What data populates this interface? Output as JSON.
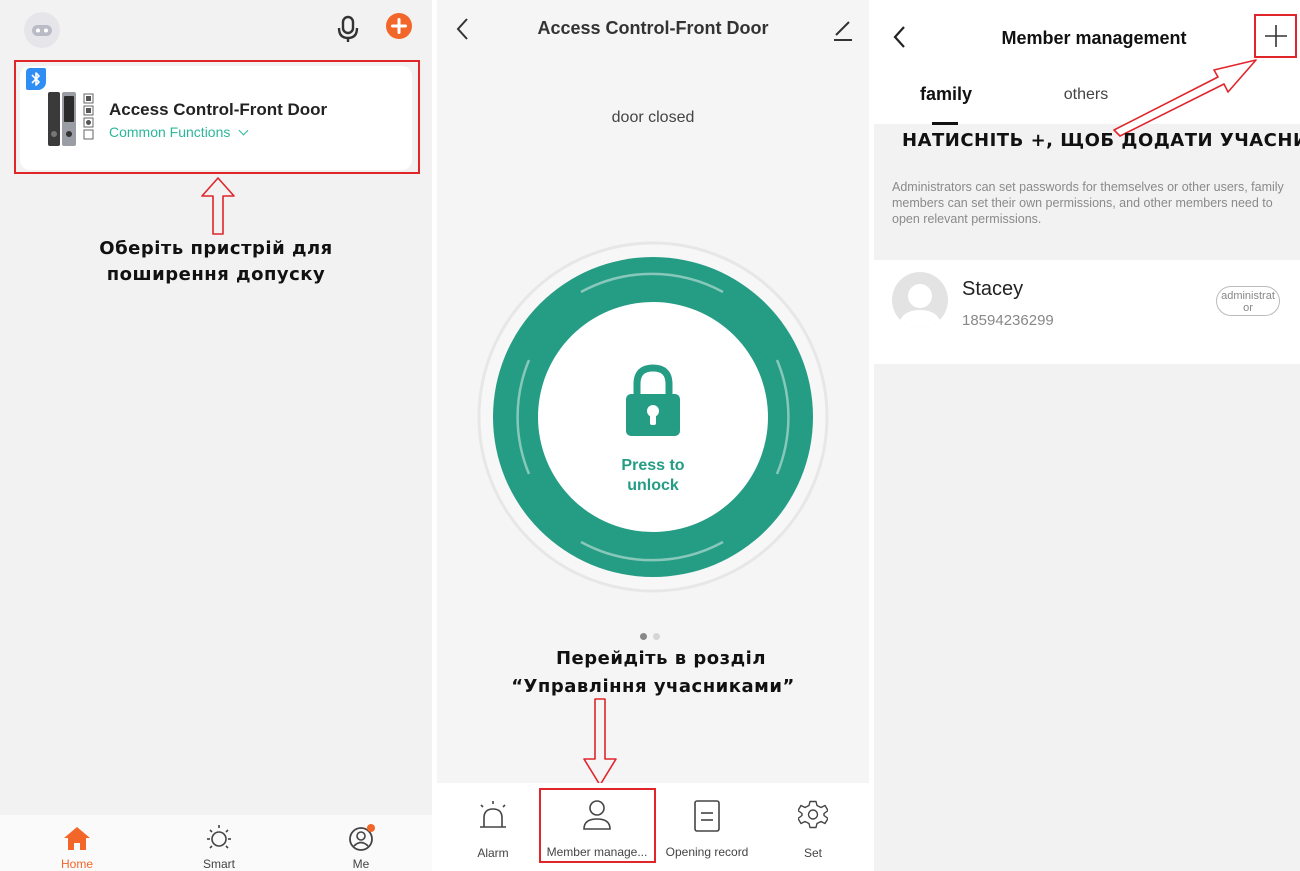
{
  "panel1": {
    "device": {
      "name": "Access Control-Front Door",
      "subtitle": "Common Functions"
    },
    "annotation": {
      "line1": "Оберіть пристрій для",
      "line2": "поширення допуску"
    },
    "nav": [
      {
        "label": "Home"
      },
      {
        "label": "Smart"
      },
      {
        "label": "Me"
      }
    ]
  },
  "panel2": {
    "title": "Access Control-Front Door",
    "status": "door closed",
    "unlock": {
      "line1": "Press to",
      "line2": "unlock"
    },
    "annotation": {
      "line1": "Перейдіть в розділ",
      "line2": "“Управління учасниками”"
    },
    "tabs": [
      {
        "label": "Alarm"
      },
      {
        "label": "Member manage..."
      },
      {
        "label": "Opening record"
      },
      {
        "label": "Set"
      }
    ]
  },
  "panel3": {
    "title": "Member management",
    "tabs": [
      {
        "label": "family"
      },
      {
        "label": "others"
      }
    ],
    "annotation": "Натисніть +, щоб додати учасника",
    "info": "Administrators can set passwords for themselves or other users, family members can set their own permissions, and other members need to open relevant permissions.",
    "member": {
      "name": "Stacey",
      "phone": "18594236299",
      "role_line1": "administrat",
      "role_line2": "or"
    }
  },
  "colors": {
    "accent_orange": "#f2662a",
    "teal": "#259c84",
    "annotation_red": "#e0262b",
    "bluetooth_blue": "#2f8ef4",
    "link_teal": "#2cb79a"
  }
}
